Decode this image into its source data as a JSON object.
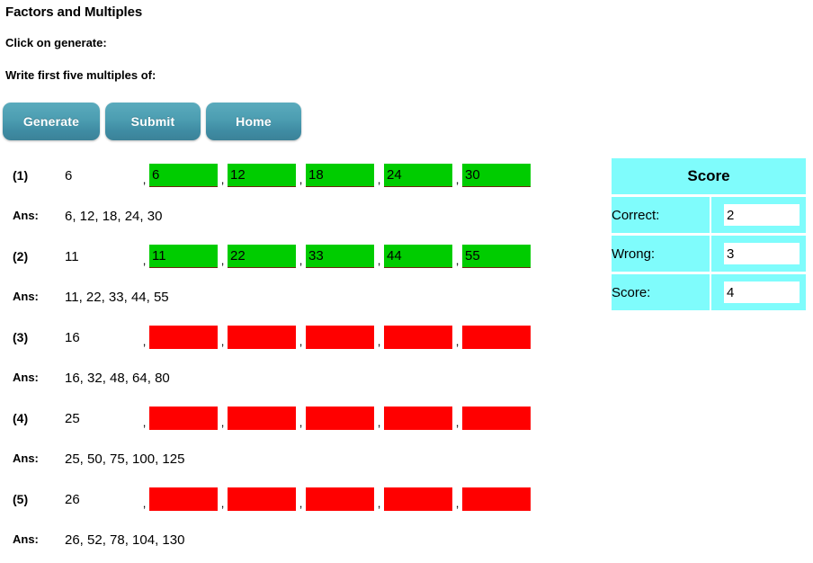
{
  "header": {
    "title": "Factors and Multiples",
    "instruction": "Click on generate:",
    "prompt": "Write first five multiples of:"
  },
  "toolbar": {
    "generate_label": "Generate",
    "submit_label": "Submit",
    "home_label": "Home"
  },
  "colors": {
    "button_teal": "#4c9db1",
    "correct_green": "#00cc00",
    "wrong_red": "#ff0000",
    "score_cyan": "#7ffcfc",
    "input_underline": "#6b2a10"
  },
  "separator": ",",
  "answer_label": "Ans:",
  "questions": [
    {
      "index": "(1)",
      "number": "6",
      "state": "correct",
      "inputs": [
        "6",
        "12",
        "18",
        "24",
        "30"
      ],
      "answer": "6, 12, 18, 24, 30"
    },
    {
      "index": "(2)",
      "number": "11",
      "state": "correct",
      "inputs": [
        "11",
        "22",
        "33",
        "44",
        "55"
      ],
      "answer": "11, 22, 33, 44, 55"
    },
    {
      "index": "(3)",
      "number": "16",
      "state": "wrong",
      "inputs": [
        "",
        "",
        "",
        "",
        ""
      ],
      "answer": "16, 32, 48, 64, 80"
    },
    {
      "index": "(4)",
      "number": "25",
      "state": "wrong",
      "inputs": [
        "",
        "",
        "",
        "",
        ""
      ],
      "answer": "25, 50, 75, 100, 125"
    },
    {
      "index": "(5)",
      "number": "26",
      "state": "wrong",
      "inputs": [
        "",
        "",
        "",
        "",
        ""
      ],
      "answer": "26, 52, 78, 104, 130"
    }
  ],
  "score": {
    "title": "Score",
    "rows": [
      {
        "label": "Correct:",
        "value": "2"
      },
      {
        "label": "Wrong:",
        "value": "3"
      },
      {
        "label": "Score:",
        "value": "4"
      }
    ]
  }
}
